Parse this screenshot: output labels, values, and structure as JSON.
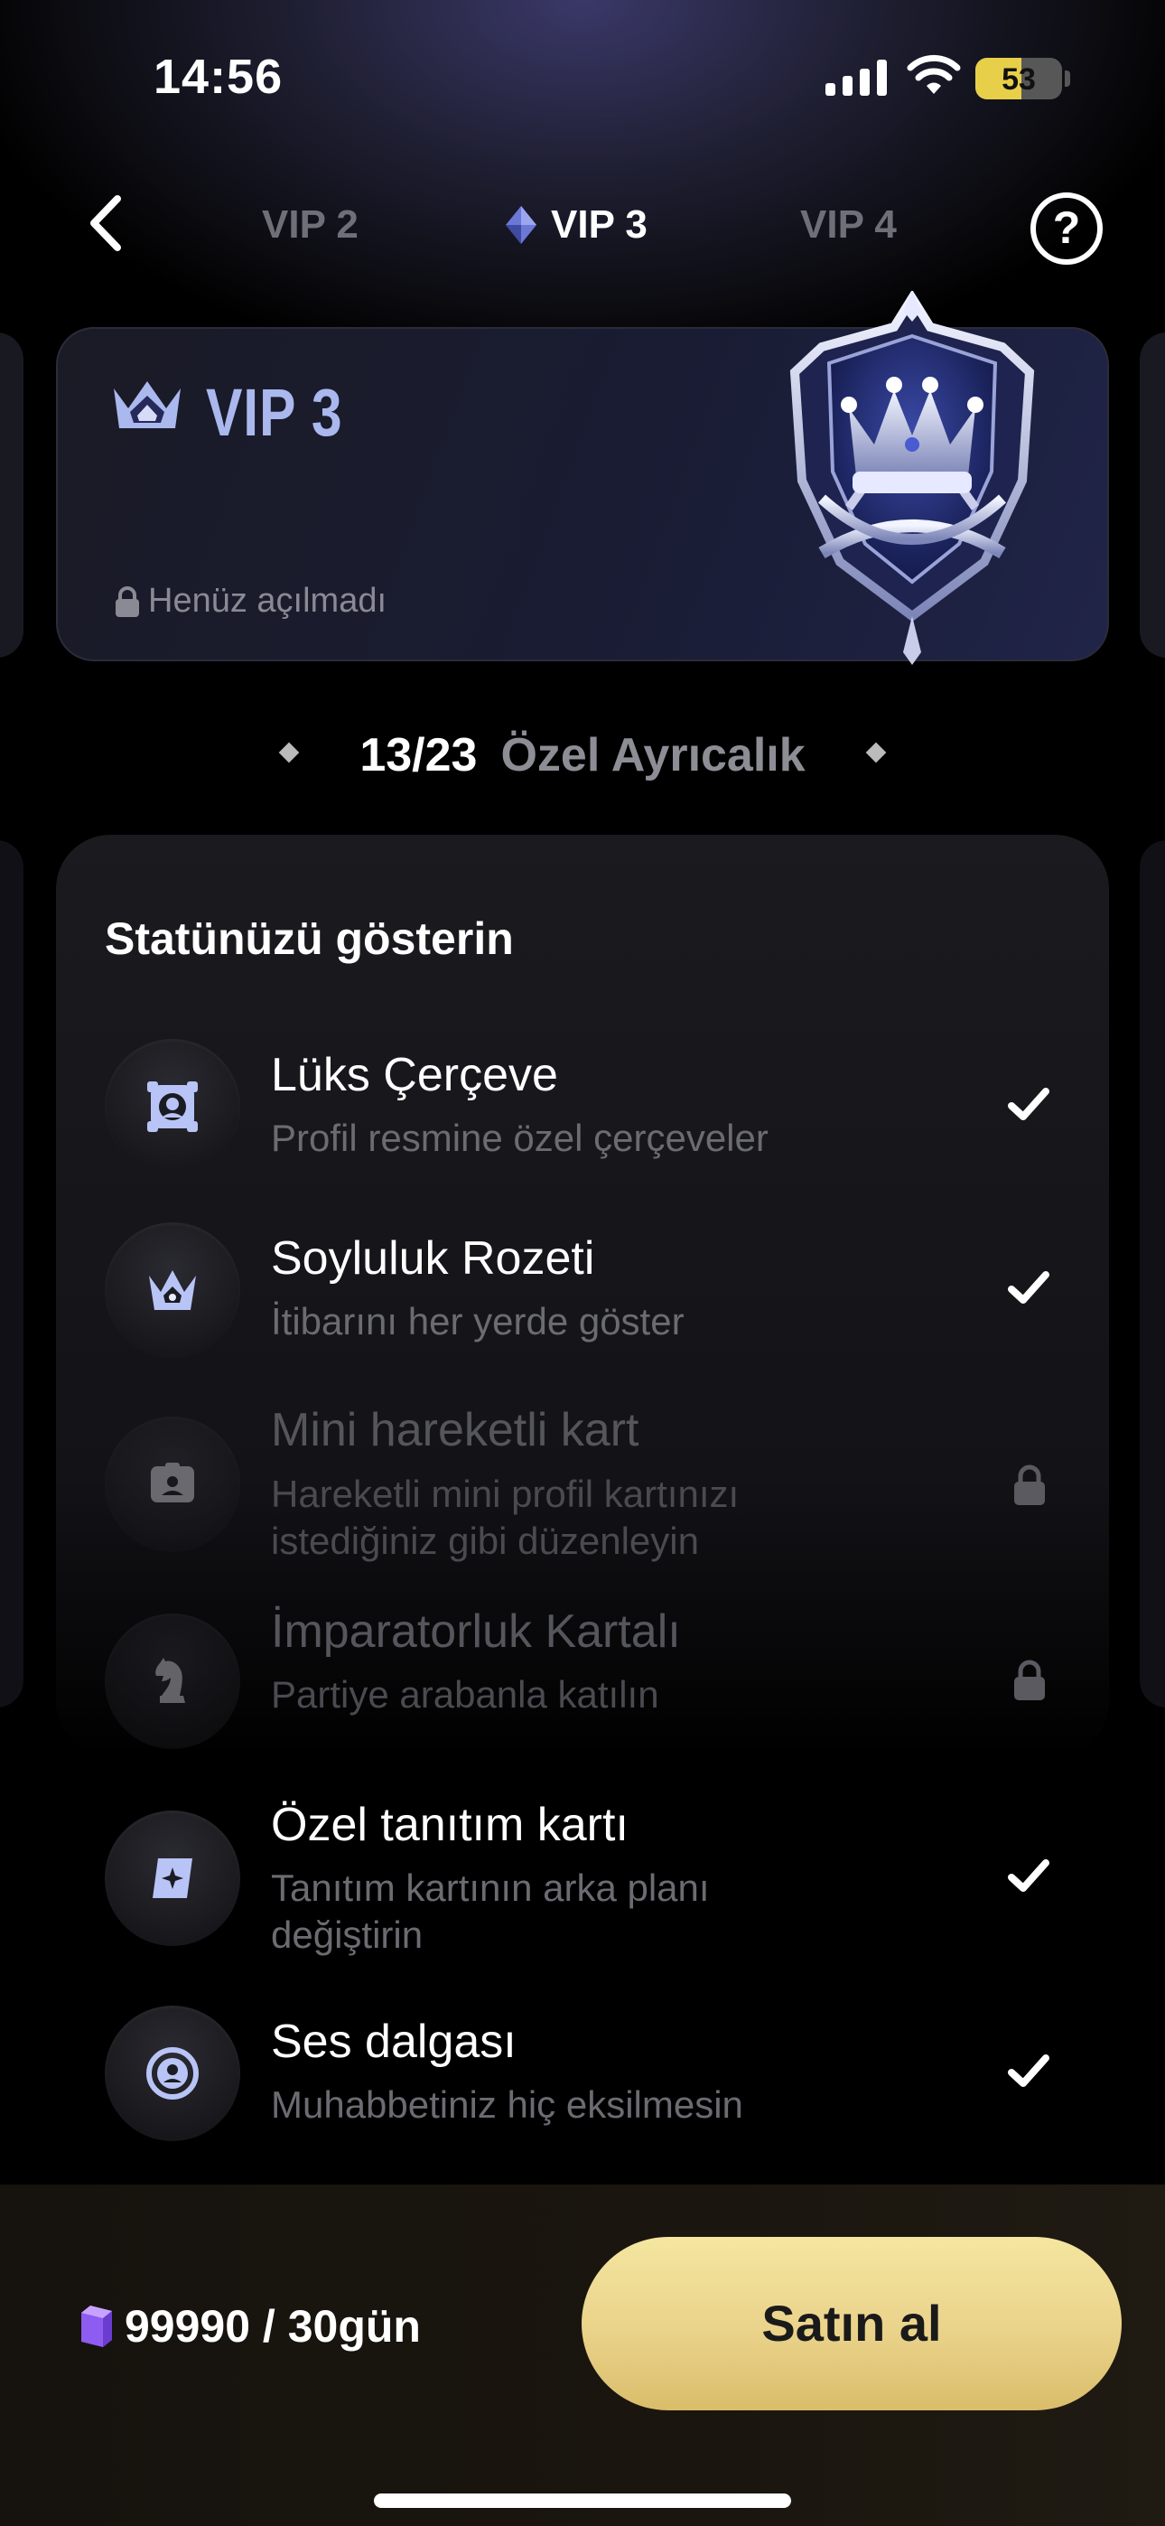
{
  "status_bar": {
    "time": "14:56",
    "battery": "53",
    "battery_level": 0.53
  },
  "nav": {
    "tabs": [
      {
        "label": "VIP 2",
        "active": false
      },
      {
        "label": "VIP 3",
        "active": true
      },
      {
        "label": "VIP 4",
        "active": false
      }
    ],
    "help": "?"
  },
  "vip_card": {
    "title": "VIP 3",
    "status": "Henüz açılmadı",
    "title_color": "#aab8ee"
  },
  "privileges": {
    "count": "13/23",
    "label": "Özel Ayrıcalık",
    "section_title": "Statünüzü gösterin",
    "items": [
      {
        "title": "Lüks Çerçeve",
        "desc": [
          "Profil resmine özel çerçeveler"
        ],
        "icon": "frame-icon",
        "status": "unlocked"
      },
      {
        "title": "Soyluluk Rozeti",
        "desc": [
          "İtibarını her yerde göster"
        ],
        "icon": "crown-icon",
        "status": "unlocked"
      },
      {
        "title": "Mini hareketli kart",
        "desc": [
          "Hareketli mini profil kartınızı",
          "istediğiniz gibi düzenleyin"
        ],
        "icon": "id-card-icon",
        "status": "locked"
      },
      {
        "title": "İmparatorluk Kartalı",
        "desc": [
          "Partiye arabanla katılın"
        ],
        "icon": "knight-icon",
        "status": "locked"
      },
      {
        "title": "Özel tanıtım kartı",
        "desc": [
          "Tanıtım kartının arka planı",
          "değiştirin"
        ],
        "icon": "intro-card-icon",
        "status": "unlocked"
      },
      {
        "title": "Ses dalgası",
        "desc": [
          "Muhabbetiniz hiç eksilmesin"
        ],
        "icon": "voice-wave-icon",
        "status": "unlocked"
      }
    ]
  },
  "purchase": {
    "price": "99990 / 30gün",
    "buy_label": "Satın al",
    "button_color": "#ead28a"
  }
}
